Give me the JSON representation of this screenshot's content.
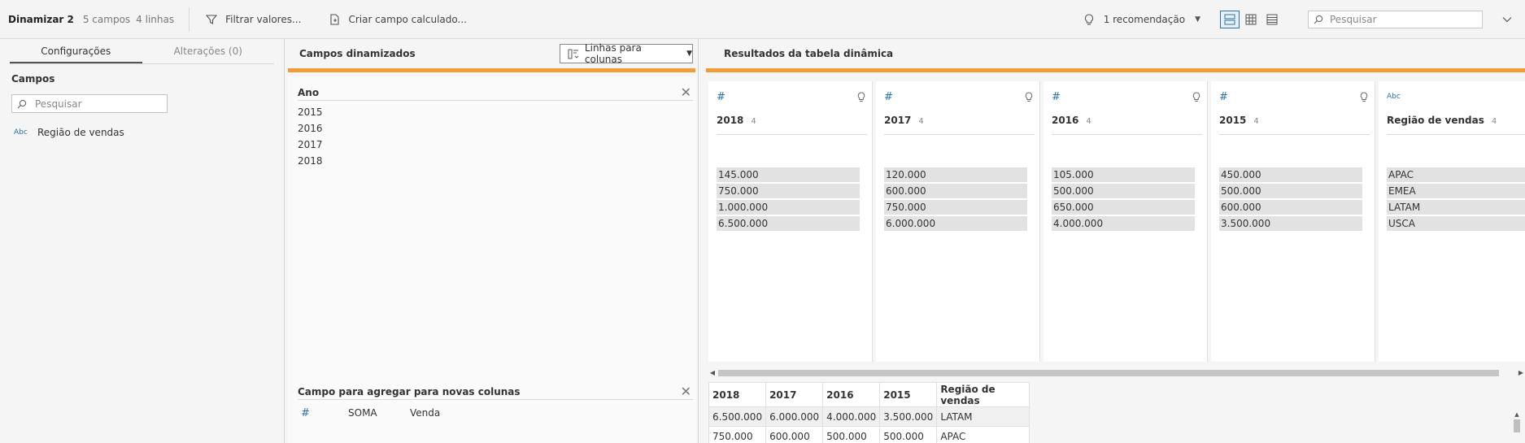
{
  "toolbar": {
    "title": "Dinamizar 2",
    "fields_count": "5 campos",
    "rows_count": "4 linhas",
    "filter_label": "Filtrar valores...",
    "calc_label": "Criar campo calculado...",
    "recommendation_label": "1 recomendação",
    "search_placeholder": "Pesquisar"
  },
  "left": {
    "tabs": [
      "Configurações",
      "Alterações (0)"
    ],
    "section_title": "Campos",
    "search_placeholder": "Pesquisar",
    "fields": [
      {
        "type": "Abc",
        "name": "Região de vendas"
      }
    ]
  },
  "middle": {
    "title": "Campos dinamizados",
    "mode_button": "Linhas para colunas",
    "pivot_field": "Ano",
    "pivot_values": [
      "2015",
      "2016",
      "2017",
      "2018"
    ],
    "agg_title": "Campo para agregar para novas colunas",
    "agg_function": "SOMA",
    "agg_field": "Venda"
  },
  "right": {
    "title": "Resultados da tabela dinâmica",
    "cards": [
      {
        "type": "#",
        "name": "2018",
        "count": "4",
        "values": [
          "145.000",
          "750.000",
          "1.000.000",
          "6.500.000"
        ]
      },
      {
        "type": "#",
        "name": "2017",
        "count": "4",
        "values": [
          "120.000",
          "600.000",
          "750.000",
          "6.000.000"
        ]
      },
      {
        "type": "#",
        "name": "2016",
        "count": "4",
        "values": [
          "105.000",
          "500.000",
          "650.000",
          "4.000.000"
        ]
      },
      {
        "type": "#",
        "name": "2015",
        "count": "4",
        "values": [
          "450.000",
          "500.000",
          "600.000",
          "3.500.000"
        ]
      },
      {
        "type": "Abc",
        "name": "Região de vendas",
        "count": "4",
        "values": [
          "APAC",
          "EMEA",
          "LATAM",
          "USCA"
        ]
      }
    ],
    "grid": {
      "headers": [
        "2018",
        "2017",
        "2016",
        "2015",
        "Região de vendas"
      ],
      "rows": [
        [
          "6.500.000",
          "6.000.000",
          "4.000.000",
          "3.500.000",
          "LATAM"
        ],
        [
          "750.000",
          "600.000",
          "500.000",
          "500.000",
          "APAC"
        ]
      ]
    }
  },
  "colors": {
    "accent_orange": "#f29c38",
    "type_blue": "#2d73a8"
  }
}
